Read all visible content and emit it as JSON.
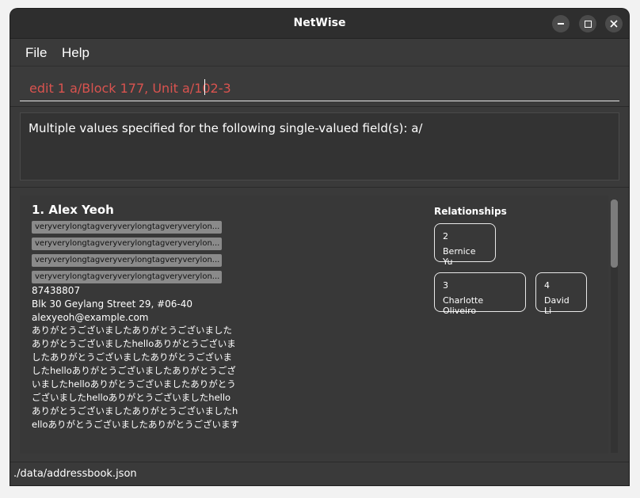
{
  "window": {
    "title": "NetWise",
    "controls": {
      "minimize": "–",
      "maximize": "□",
      "close": "✕"
    }
  },
  "menu": {
    "items": [
      "File",
      "Help"
    ]
  },
  "command_box": {
    "value": "edit 1 a/Block 177, Unit a/102-3"
  },
  "result_display": {
    "text": "Multiple values specified for the following single-valued field(s): a/"
  },
  "person_card": {
    "index_name": "1. Alex Yeoh",
    "tags": [
      "veryverylongtagveryverylongtagveryverylon...",
      "veryverylongtagveryverylongtagveryverylon...",
      "veryverylongtagveryverylongtagveryverylon...",
      "veryverylongtagveryverylongtagveryverylon..."
    ],
    "phone": "87438807",
    "address": "Blk 30 Geylang Street 29, #06-40",
    "email": "alexyeoh@example.com",
    "remark": "ありがとうございましたありがとうございましたありがとうございましたhelloありがとうございましたありがとうございましたありがとうございましたhelloありがとうございましたありがとうございましたhelloありがとうございましたありがとうございましたhelloありがとうございましたhelloありがとうございましたありがとうございましたhelloありがとうございましたありがとうございます",
    "relationships_title": "Relationships",
    "relationships": [
      {
        "index": "2",
        "name": "Bernice Yu"
      },
      {
        "index": "3",
        "name": "Charlotte Oliveiro"
      },
      {
        "index": "4",
        "name": "David Li"
      }
    ]
  },
  "status_bar": {
    "path": "./data/addressbook.json"
  },
  "colors": {
    "command_text": "#d9534f",
    "background": "#3a3a3a",
    "tag_bg": "#8a8a8a"
  }
}
